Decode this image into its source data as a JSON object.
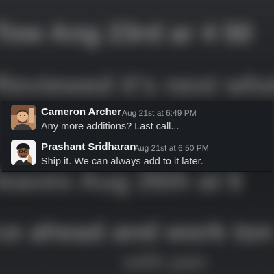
{
  "messages": [
    {
      "author": "Cameron Archer",
      "timestamp": "Aug 21st at 6:49 PM",
      "text": "Any more additions? Last call...",
      "avatar_icon": "person-avatar-icon"
    },
    {
      "author": "Prashant Sridharan",
      "timestamp": "Aug 21st at 6:50 PM",
      "text": "Ship it. We can always add to it later.",
      "avatar_icon": "cartoon-avatar-icon"
    }
  ],
  "colors": {
    "card_background": "#1a1d21",
    "author": "#f3f3f3",
    "timestamp": "#9c9ea3",
    "message_text": "#d6d7d9"
  }
}
